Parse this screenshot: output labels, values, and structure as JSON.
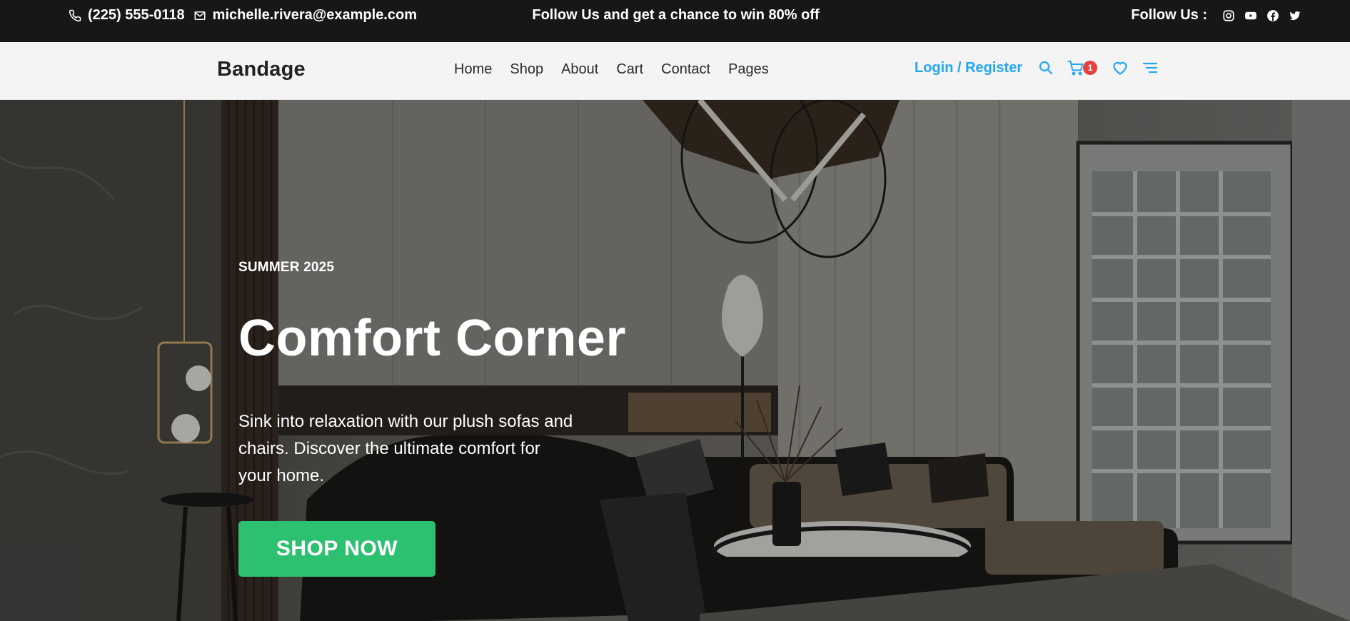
{
  "topbar": {
    "phone": "(225) 555-0118",
    "email": "michelle.rivera@example.com",
    "promo": "Follow Us and get a chance to win 80% off",
    "follow_label": "Follow Us :",
    "social_icons": [
      "instagram-icon",
      "youtube-icon",
      "facebook-icon",
      "twitter-icon"
    ]
  },
  "navbar": {
    "brand": "Bandage",
    "menu": [
      "Home",
      "Shop",
      "About",
      "Cart",
      "Contact",
      "Pages"
    ],
    "login": "Login / Register",
    "cart_count": "1",
    "icons": [
      "search-icon",
      "cart-icon",
      "heart-icon",
      "menu-icon"
    ]
  },
  "hero": {
    "season": "SUMMER 2025",
    "title": "Comfort Corner",
    "text": "Sink into relaxation with our plush sofas and chairs. Discover the ultimate comfort for your home.",
    "button": "SHOP NOW"
  },
  "colors": {
    "topbar_bg": "#171717",
    "accent_blue": "#23a6f0",
    "button_green": "#2dc071",
    "badge_red": "#e74040"
  }
}
